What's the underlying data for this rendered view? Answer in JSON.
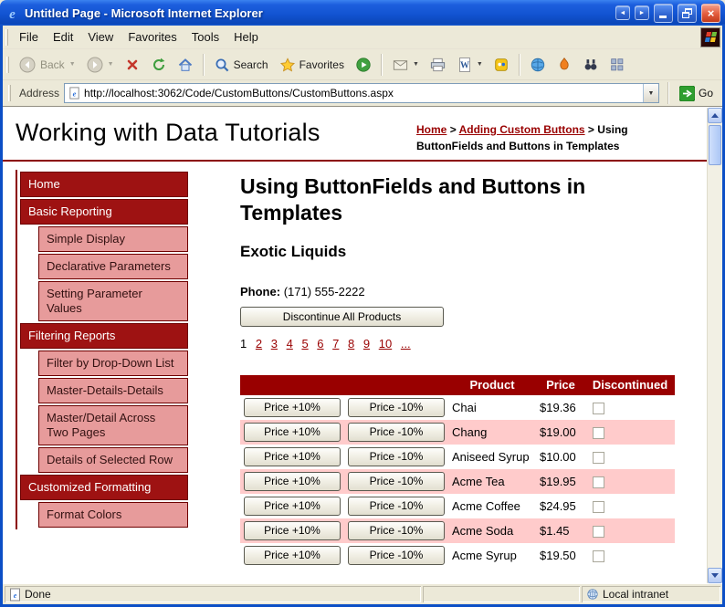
{
  "window": {
    "title": "Untitled Page - Microsoft Internet Explorer"
  },
  "menu": {
    "items": [
      "File",
      "Edit",
      "View",
      "Favorites",
      "Tools",
      "Help"
    ]
  },
  "toolbar": {
    "back_label": "Back",
    "search_label": "Search",
    "favorites_label": "Favorites"
  },
  "address": {
    "label": "Address",
    "url": "http://localhost:3062/Code/CustomButtons/CustomButtons.aspx",
    "go_label": "Go"
  },
  "page": {
    "site_title": "Working with Data Tutorials",
    "breadcrumb": {
      "home": "Home",
      "separator": ">",
      "section": "Adding Custom Buttons",
      "current": "Using ButtonFields and Buttons in Templates"
    },
    "sidebar": {
      "items": [
        {
          "label": "Home",
          "type": "section"
        },
        {
          "label": "Basic Reporting",
          "type": "section"
        },
        {
          "label": "Simple Display",
          "type": "sub"
        },
        {
          "label": "Declarative Parameters",
          "type": "sub"
        },
        {
          "label": "Setting Parameter Values",
          "type": "sub"
        },
        {
          "label": "Filtering Reports",
          "type": "section"
        },
        {
          "label": "Filter by Drop-Down List",
          "type": "sub"
        },
        {
          "label": "Master-Details-Details",
          "type": "sub"
        },
        {
          "label": "Master/Detail Across Two Pages",
          "type": "sub"
        },
        {
          "label": "Details of Selected Row",
          "type": "sub"
        },
        {
          "label": "Customized Formatting",
          "type": "section"
        },
        {
          "label": "Format Colors",
          "type": "sub"
        }
      ]
    },
    "main": {
      "heading": "Using ButtonFields and Buttons in Templates",
      "supplier": "Exotic Liquids",
      "phone_label": "Phone:",
      "phone_value": "(171) 555-2222",
      "discontinue_button": "Discontinue All Products",
      "pager": {
        "current": "1",
        "links": [
          "2",
          "3",
          "4",
          "5",
          "6",
          "7",
          "8",
          "9",
          "10",
          "..."
        ]
      },
      "grid": {
        "headers": {
          "product": "Product",
          "price": "Price",
          "discontinued": "Discontinued"
        },
        "increase_label": "Price +10%",
        "decrease_label": "Price -10%",
        "rows": [
          {
            "product": "Chai",
            "price": "$19.36"
          },
          {
            "product": "Chang",
            "price": "$19.00"
          },
          {
            "product": "Aniseed Syrup",
            "price": "$10.00"
          },
          {
            "product": "Acme Tea",
            "price": "$19.95"
          },
          {
            "product": "Acme Coffee",
            "price": "$24.95"
          },
          {
            "product": "Acme Soda",
            "price": "$1.45"
          },
          {
            "product": "Acme Syrup",
            "price": "$19.50"
          }
        ]
      }
    }
  },
  "status": {
    "left": "Done",
    "zone": "Local intranet"
  },
  "colors": {
    "accent": "#990000",
    "table_header_bg": "#990000",
    "alt_row_bg": "#ffcbcb",
    "sidebar_section_bg": "#9e1212",
    "sidebar_sub_bg": "#e79b9b",
    "titlebar_blue": "#1254d2",
    "go_green": "#2f9e2f"
  }
}
